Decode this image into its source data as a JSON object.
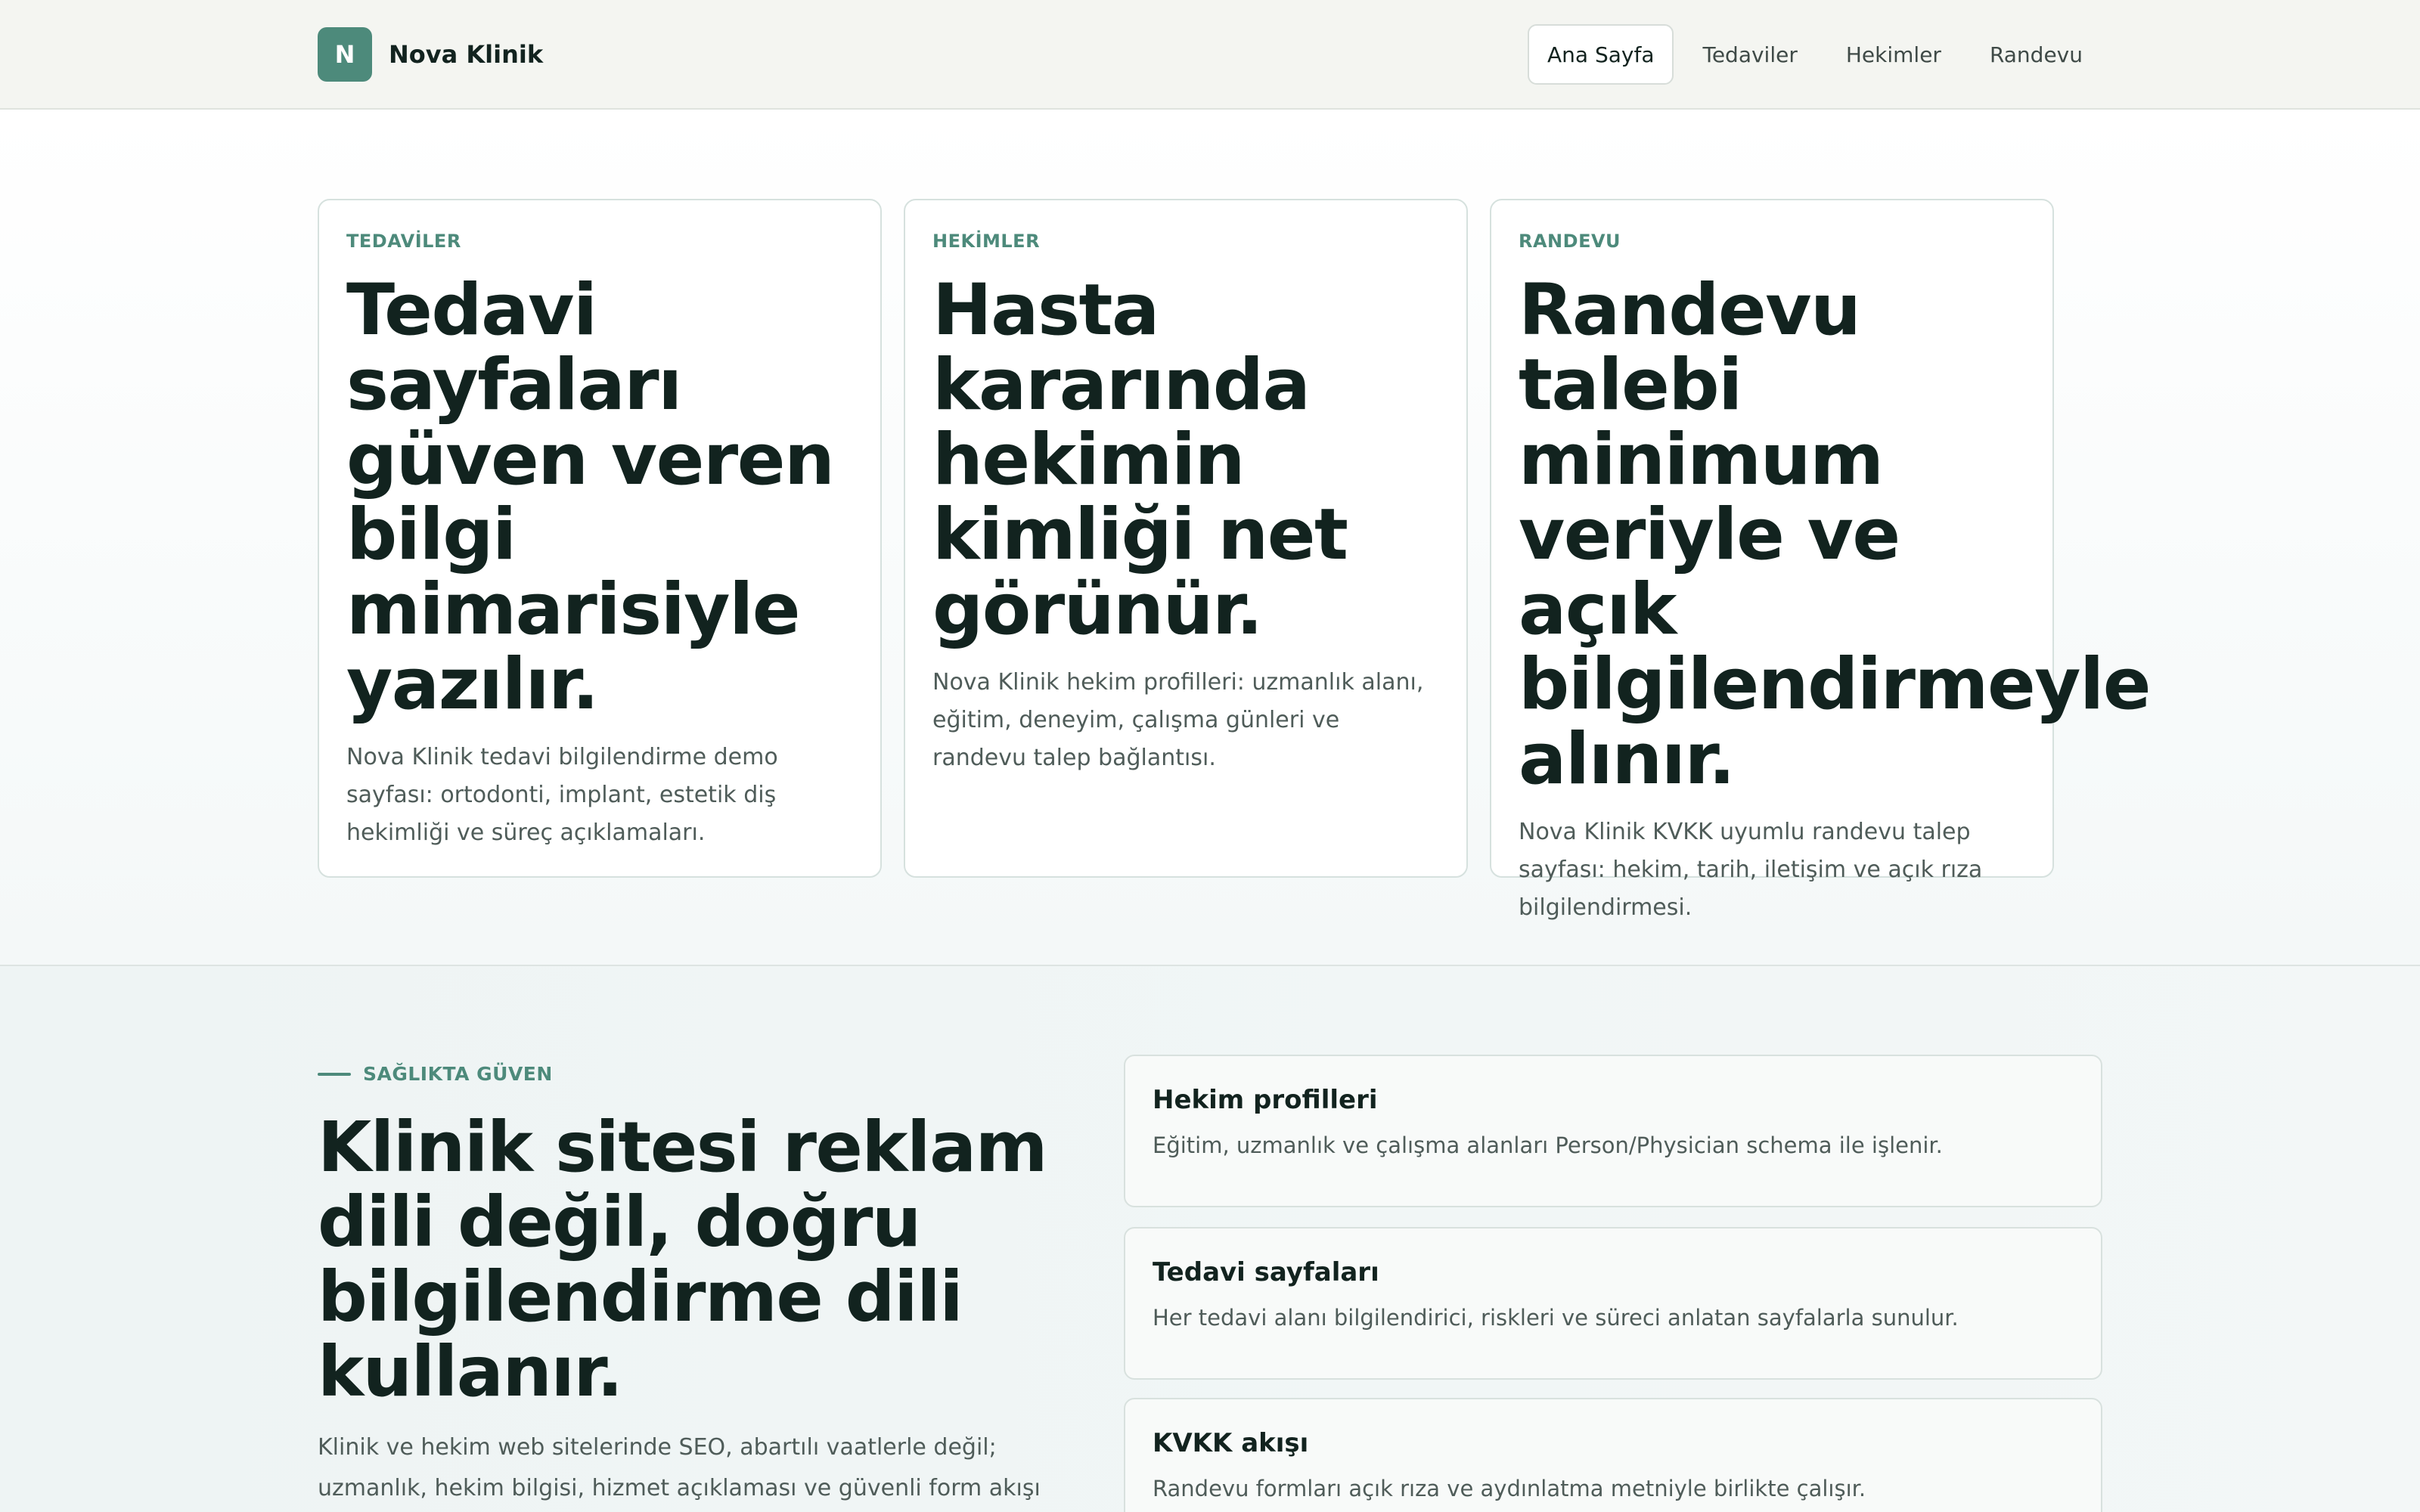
{
  "header": {
    "logo_letter": "N",
    "brand_name": "Nova Klinik",
    "nav": [
      {
        "label": "Ana Sayfa",
        "active": true
      },
      {
        "label": "Tedaviler",
        "active": false
      },
      {
        "label": "Hekimler",
        "active": false
      },
      {
        "label": "Randevu",
        "active": false
      }
    ]
  },
  "cards": [
    {
      "kicker": "TEDAVİLER",
      "title": "Tedavi sayfaları güven veren bilgi mimarisiyle yazılır.",
      "text": "Nova Klinik tedavi bilgilendirme demo sayfası: ortodonti, implant, estetik diş hekimliği ve süreç açıklamaları."
    },
    {
      "kicker": "HEKİMLER",
      "title": "Hasta kararında hekimin kimliği net görünür.",
      "text": "Nova Klinik hekim profilleri: uzmanlık alanı, eğitim, deneyim, çalışma günleri ve randevu talep bağlantısı."
    },
    {
      "kicker": "RANDEVU",
      "title": "Randevu talebi minimum veriyle ve açık bilgilendirmeyle alınır.",
      "text": "Nova Klinik KVKK uyumlu randevu talep sayfası: hekim, tarih, iletişim ve açık rıza bilgilendirmesi."
    }
  ],
  "section": {
    "eyebrow": "SAĞLIKTA GÜVEN",
    "title": "Klinik sitesi reklam dili değil, doğru bilgilendirme dili kullanır.",
    "text": "Klinik ve hekim web sitelerinde SEO, abartılı vaatlerle değil; uzmanlık, hekim bilgisi, hizmet açıklaması ve güvenli form akışı ile",
    "features": [
      {
        "title": "Hekim profilleri",
        "text": "Eğitim, uzmanlık ve çalışma alanları Person/Physician schema ile işlenir."
      },
      {
        "title": "Tedavi sayfaları",
        "text": "Her tedavi alanı bilgilendirici, riskleri ve süreci anlatan sayfalarla sunulur."
      },
      {
        "title": "KVKK akışı",
        "text": "Randevu formları açık rıza ve aydınlatma metniyle birlikte çalışır."
      }
    ]
  },
  "colors": {
    "accent": "#4d8a7b",
    "ink": "#12231f",
    "muted": "#4f5c59",
    "header_bg": "#f4f5f1"
  }
}
